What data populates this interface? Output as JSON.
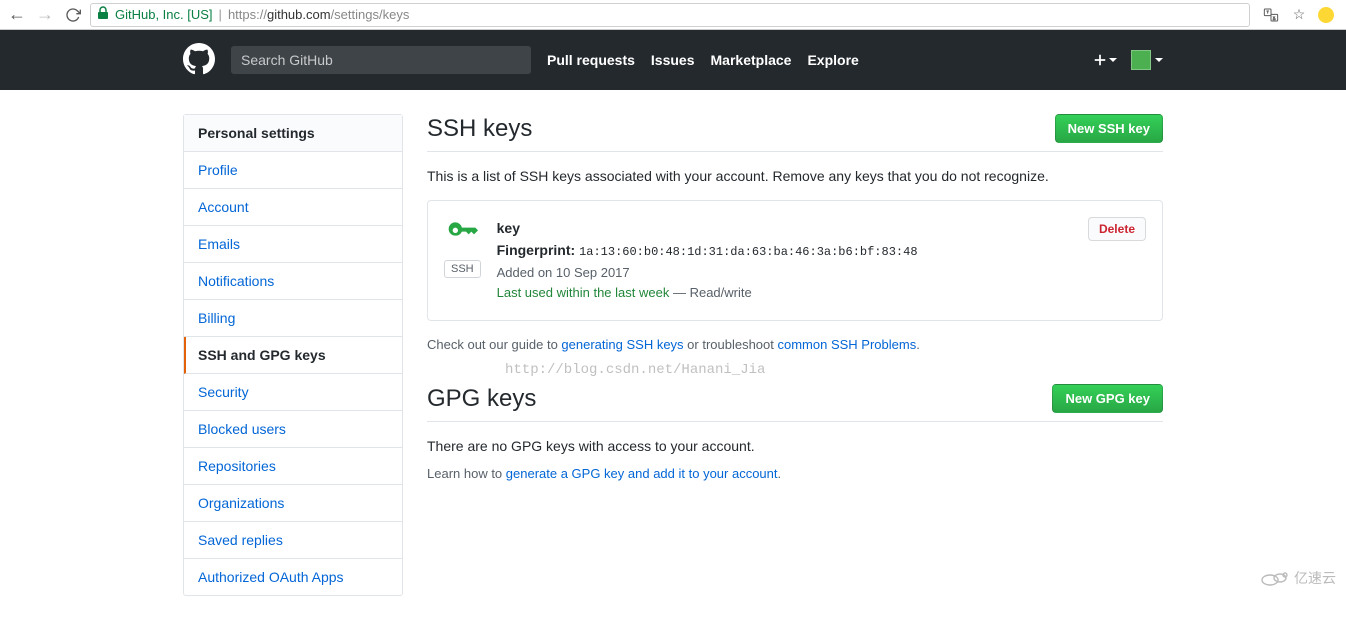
{
  "browser": {
    "ev_label": "GitHub, Inc. [US]",
    "url_protocol": "https://",
    "url_host": "github.com",
    "url_path": "/settings/keys"
  },
  "header": {
    "search_placeholder": "Search GitHub",
    "nav": [
      "Pull requests",
      "Issues",
      "Marketplace",
      "Explore"
    ]
  },
  "sidebar": {
    "heading": "Personal settings",
    "items": [
      "Profile",
      "Account",
      "Emails",
      "Notifications",
      "Billing",
      "SSH and GPG keys",
      "Security",
      "Blocked users",
      "Repositories",
      "Organizations",
      "Saved replies",
      "Authorized OAuth Apps"
    ],
    "selected_index": 5
  },
  "ssh": {
    "heading": "SSH keys",
    "new_button": "New SSH key",
    "lead": "This is a list of SSH keys associated with your account. Remove any keys that you do not recognize.",
    "key": {
      "title": "key",
      "badge": "SSH",
      "fingerprint_label": "Fingerprint:",
      "fingerprint": "1a:13:60:b0:48:1d:31:da:63:ba:46:3a:b6:bf:83:48",
      "added": "Added on 10 Sep 2017",
      "last_used": "Last used within the last week",
      "sep": " — ",
      "access": "Read/write",
      "delete": "Delete"
    },
    "guide_prefix": "Check out our guide to ",
    "guide_link": "generating SSH keys",
    "guide_mid": " or troubleshoot ",
    "guide_link2": "common SSH Problems",
    "guide_suffix": "."
  },
  "gpg": {
    "heading": "GPG keys",
    "new_button": "New GPG key",
    "empty": "There are no GPG keys with access to your account.",
    "learn_prefix": "Learn how to ",
    "learn_link": "generate a GPG key and add it to your account",
    "learn_suffix": "."
  },
  "watermark": "http://blog.csdn.net/Hanani_Jia",
  "corner_logo": "亿速云"
}
